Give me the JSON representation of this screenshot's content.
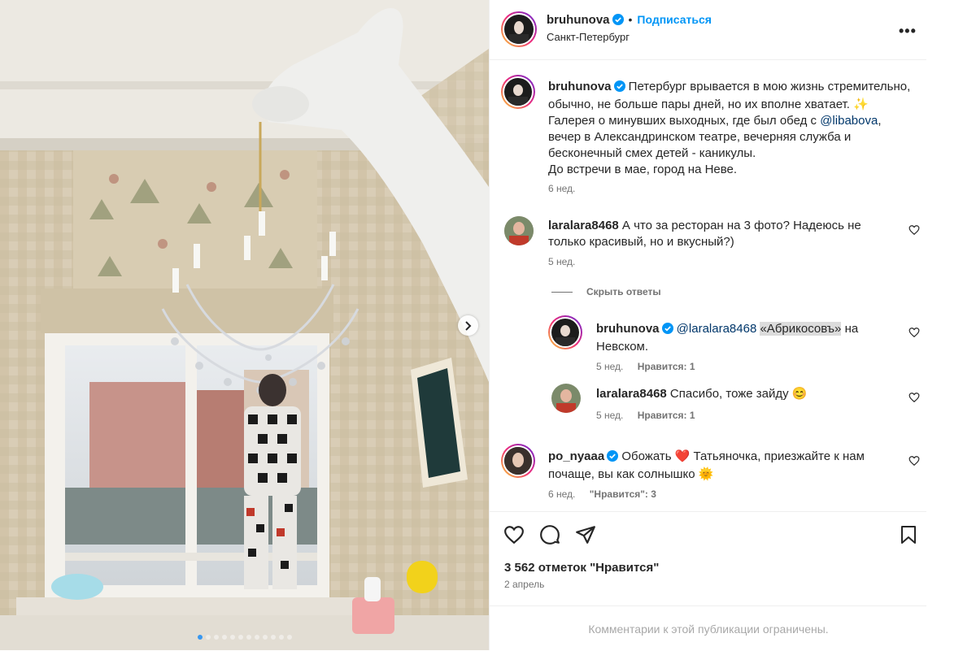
{
  "header": {
    "username": "bruhunova",
    "follow_label": "Подписаться",
    "separator": "•",
    "location": "Санкт-Петербург",
    "more_label": "•••"
  },
  "caption": {
    "username": "bruhunova",
    "text_part1": "Петербург врывается в мою жизнь стремительно, обычно, не больше пары дней, но их вполне хватает. ✨ Галерея о минувших выходных, где был обед с ",
    "mention": "@libabova",
    "text_part2": ", вечер в Александринском театре, вечерняя служба и бесконечный смех детей - каникулы.",
    "text_line_last": "До встречи в мае, город на Неве.",
    "time": "6 нед."
  },
  "comments": [
    {
      "username": "laralara8468",
      "text": "А что за ресторан на 3 фото? Надеюсь не только красивый, но и вкусный?)",
      "time": "5 нед."
    }
  ],
  "hide_replies_label": "Скрыть ответы",
  "replies": [
    {
      "username": "bruhunova",
      "mention": "@laralara8468",
      "highlight": "«Абрикосовъ»",
      "text": " на Невском.",
      "time": "5 нед.",
      "likes_label": "Нравится: 1"
    },
    {
      "username": "laralara8468",
      "text": "Спасибо, тоже зайду 😊",
      "time": "5 нед.",
      "likes_label": "Нравится: 1"
    }
  ],
  "comment3": {
    "username": "po_nyaaa",
    "text": "Обожать ❤️ Татьяночка, приезжайте к нам почаще, вы как солнышко 🌞",
    "time": "6 нед.",
    "likes_label": "\"Нравится\": 3"
  },
  "post": {
    "likes": "3 562 отметок \"Нравится\"",
    "date": "2 апрель",
    "comments_limited": "Комментарии к этой публикации ограничены."
  },
  "carousel": {
    "total_dots": 12,
    "active_index": 0
  },
  "colors": {
    "accent": "#0095f6",
    "verified": "#0095f6",
    "heart_red": "#ed4956"
  }
}
